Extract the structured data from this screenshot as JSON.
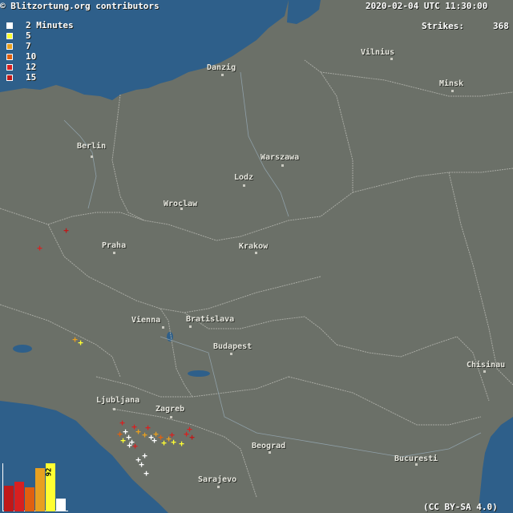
{
  "header": {
    "attribution": "© Blitzortung.org contributors",
    "timestamp": "2020-02-04 UTC 11:30:00",
    "strikes_label": "Strikes:",
    "strikes_count": "368"
  },
  "legend": {
    "items": [
      {
        "label": "2 Minutes",
        "color": "#ffffff"
      },
      {
        "label": "5",
        "color": "#ffff33"
      },
      {
        "label": "7",
        "color": "#e8a020"
      },
      {
        "label": "10",
        "color": "#e06010"
      },
      {
        "label": "12",
        "color": "#d82020"
      },
      {
        "label": "15",
        "color": "#c01818"
      }
    ]
  },
  "cities": [
    {
      "name": "Vilnius"
    },
    {
      "name": "Danzig"
    },
    {
      "name": "Minsk"
    },
    {
      "name": "Berlin"
    },
    {
      "name": "Warszawa"
    },
    {
      "name": "Lodz"
    },
    {
      "name": "Wroclaw"
    },
    {
      "name": "Praha"
    },
    {
      "name": "Krakow"
    },
    {
      "name": "Vienna"
    },
    {
      "name": "Bratislava"
    },
    {
      "name": "Budapest"
    },
    {
      "name": "Chisinau"
    },
    {
      "name": "Ljubljana"
    },
    {
      "name": "Zagreb"
    },
    {
      "name": "Beograd"
    },
    {
      "name": "Bucuresti"
    },
    {
      "name": "Sarajevo"
    }
  ],
  "histogram": {
    "max_label": "92",
    "colors": [
      "#c01818",
      "#d82020",
      "#e06010",
      "#e8a020",
      "#ffff33",
      "#ffffff"
    ],
    "values": [
      32,
      37,
      30,
      54,
      60,
      16
    ]
  },
  "footer": {
    "license": "(CC BY-SA 4.0)"
  },
  "colors": {
    "land": "#6b7068",
    "water": "#2e5f8a",
    "border": "#a8aaa3"
  }
}
